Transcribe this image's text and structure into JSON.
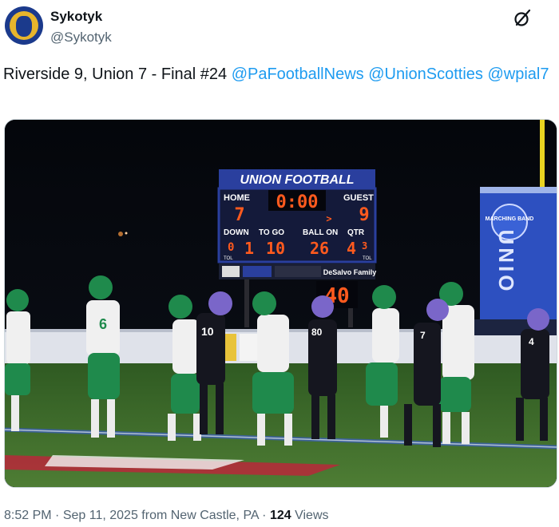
{
  "author": {
    "display_name": "Sykotyk",
    "handle": "@Sykotyk",
    "avatar_icon": "helmet-logo-icon"
  },
  "tweet": {
    "text": "Riverside 9, Union 7 - Final #24",
    "mentions": [
      "@PaFootballNews",
      "@UnionScotties",
      "@wpial7"
    ]
  },
  "photo": {
    "scoreboard": {
      "header": "UNION FOOTBALL",
      "home_label": "HOME",
      "guest_label": "GUEST",
      "clock": "0:00",
      "home_score": "7",
      "guest_score": "9",
      "possession": ">",
      "down_label": "DOWN",
      "togo_label": "TO GO",
      "ballon_label": "BALL ON",
      "qtr_label": "QTR",
      "tol_label": "TOL",
      "home_tol": "0",
      "down": "1",
      "togo": "10",
      "ballon": "26",
      "qtr": "4",
      "guest_tol": "3",
      "sponsor": "DeSalvo Family",
      "play_clock": "40"
    },
    "banner": {
      "top_text": "MARCHING BAND",
      "vertical_text": "UNIO"
    },
    "colors": {
      "scoreboard_blue": "#2a3f9e",
      "led_red": "#ff5a1e",
      "green_jersey": "#1f8a4c",
      "field_green": "#3f6f2c"
    }
  },
  "footer": {
    "time": "8:52 PM",
    "date": "Sep 11, 2025",
    "location": "from New Castle, PA",
    "views_count": "124",
    "views_label": "Views",
    "sep": "·"
  }
}
